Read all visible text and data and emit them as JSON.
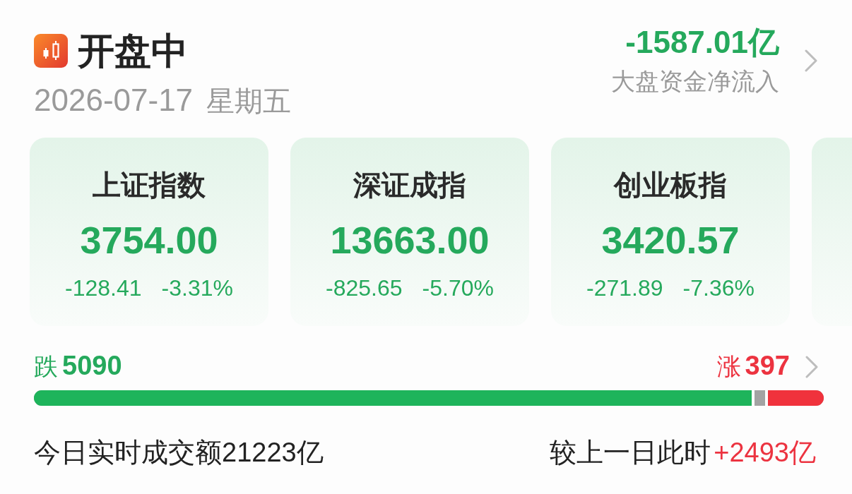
{
  "status": {
    "title": "开盘中",
    "date": "2026-07-17",
    "weekday": "星期五"
  },
  "net_flow": {
    "value": "-1587.01亿",
    "label": "大盘资金净流入",
    "rising": false
  },
  "indices": [
    {
      "name": "上证指数",
      "value": "3754.00",
      "change": "-128.41",
      "change_pct": "-3.31%",
      "rising": false
    },
    {
      "name": "深证成指",
      "value": "13663.00",
      "change": "-825.65",
      "change_pct": "-5.70%",
      "rising": false
    },
    {
      "name": "创业板指",
      "value": "3420.57",
      "change": "-271.89",
      "change_pct": "-7.36%",
      "rising": false
    }
  ],
  "more_cards_clipped": true,
  "breadth": {
    "fall": {
      "label": "跌",
      "count": "5090",
      "level": 0.912
    },
    "rise": {
      "label": "涨",
      "count": "397",
      "level": 0.074
    }
  },
  "turnover": {
    "label": "今日实时成交额21223亿",
    "compare_label": "较上一日此时",
    "compare_value": "+2493亿",
    "rising": true
  }
}
